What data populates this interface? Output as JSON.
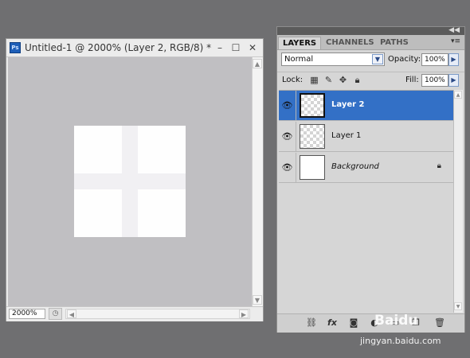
{
  "document": {
    "title": "Untitled-1 @ 2000% (Layer 2, RGB/8) *",
    "app_icon_label": "Ps",
    "controls": {
      "minimize": "–",
      "maximize": "☐",
      "close": "✕"
    },
    "zoom": "2000%"
  },
  "layers_panel": {
    "tabs": [
      "LAYERS",
      "CHANNELS",
      "PATHS"
    ],
    "blend_mode": "Normal",
    "opacity_label": "Opacity:",
    "opacity_value": "100%",
    "lock_label": "Lock:",
    "fill_label": "Fill:",
    "fill_value": "100%",
    "layers": [
      {
        "name": "Layer 2",
        "selected": true,
        "visible": true
      },
      {
        "name": "Layer 1",
        "selected": false,
        "visible": true
      },
      {
        "name": "Background",
        "selected": false,
        "visible": true,
        "locked": true
      }
    ],
    "footer_icons": [
      "link-icon",
      "fx-icon",
      "mask-icon",
      "adjustment-icon",
      "group-icon",
      "new-layer-icon",
      "trash-icon"
    ],
    "fx_label": "fx"
  },
  "colors": {
    "selection": "#3370c6",
    "canvas_bg": "#c0bfc2",
    "desktop": "#6f6f71"
  },
  "watermark": {
    "logo_text": "Baidu",
    "url": "jingyan.baidu.com"
  }
}
